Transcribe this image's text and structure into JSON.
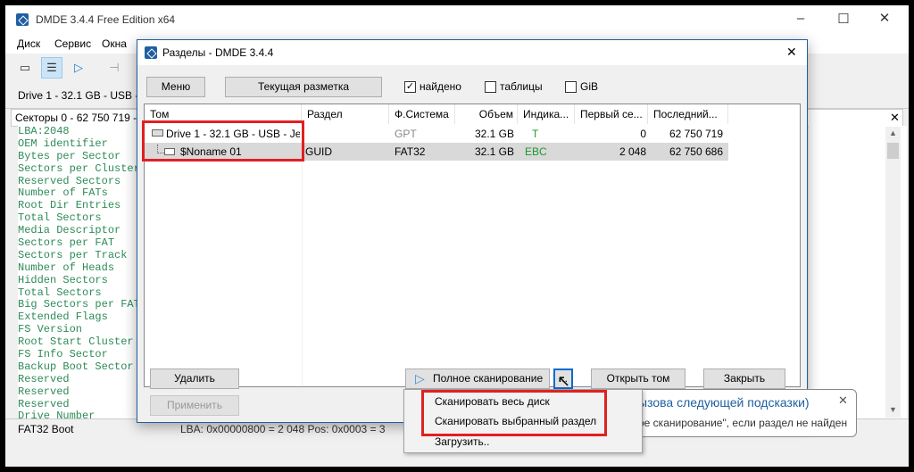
{
  "main": {
    "title": "DMDE 3.4.4 Free Edition x64",
    "menu": [
      "Диск",
      "Сервис",
      "Окна"
    ],
    "drive_label": "Drive 1 - 32.1 GB - USB - J",
    "sectors_label": "Секторы 0 - 62 750 719 -",
    "fields": [
      "LBA:2048",
      "OEM identifier",
      "Bytes per Sector",
      "Sectors per Cluster",
      "Reserved Sectors",
      "Number of FATs",
      "Root Dir Entries",
      "Total Sectors",
      "Media Descriptor",
      "Sectors per FAT",
      "Sectors per Track",
      "Number of Heads",
      "Hidden Sectors",
      "Total Sectors",
      "Big Sectors per FAT",
      "Extended Flags",
      "FS Version",
      "Root Start Cluster",
      "FS Info Sector",
      "Backup Boot Sector",
      "Reserved",
      "Reserved",
      "Reserved",
      "Drive Number"
    ],
    "status_left": "FAT32 Boot",
    "status_info": "LBA: 0x00000800 = 2 048  Pos: 0x0003 = 3"
  },
  "dialog": {
    "title": "Разделы - DMDE 3.4.4",
    "menu_button": "Меню",
    "layout_button": "Текущая разметка",
    "filters": [
      {
        "label": "найдено",
        "checked": "✓"
      },
      {
        "label": "таблицы",
        "checked": ""
      },
      {
        "label": "GiB",
        "checked": ""
      }
    ],
    "columns": [
      "Том",
      "Раздел",
      "Ф.Система",
      "Объем",
      "Индика...",
      "Первый се...",
      "Последний..."
    ],
    "rows": [
      {
        "volume": "Drive 1 - 32.1 GB - USB - Je...",
        "partition": "",
        "fs": "GPT",
        "size": "32.1 GB",
        "indicator": "T",
        "first": "0",
        "last": "62 750 719"
      },
      {
        "volume": "$Noname 01",
        "partition": "GUID",
        "fs": "FAT32",
        "size": "32.1 GB",
        "indicator": "EBC",
        "first": "2 048",
        "last": "62 750 686"
      }
    ],
    "delete_button": "Удалить",
    "apply_button": "Применить",
    "scan_button": "Полное сканирование",
    "more_button": "...",
    "open_button": "Открыть том",
    "close_button": "Закрыть"
  },
  "popup": {
    "items": [
      "Сканировать весь диск",
      "Сканировать выбранный раздел",
      "Загрузить.."
    ]
  },
  "hint": {
    "line1": "ызова следующей подсказки)",
    "line2": "ое сканирование\", если раздел не найден"
  },
  "colors": {
    "accent": "#1f5fa0",
    "highlight": "#e02020",
    "field_text": "#2e8b57"
  }
}
